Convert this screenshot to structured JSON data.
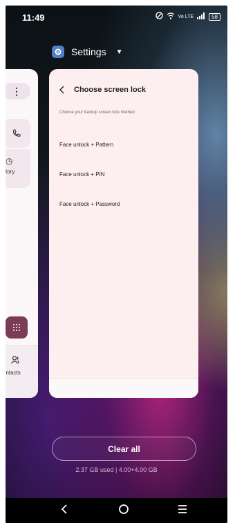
{
  "status_bar": {
    "time": "11:49",
    "icons": [
      "nfc-icon",
      "wifi-icon",
      "volte-icon",
      "signal-icon",
      "battery-icon"
    ],
    "volte_label": "Vo LTE",
    "battery_label": "58"
  },
  "recent_app": {
    "name": "Settings"
  },
  "left_card": {
    "history_label": "story",
    "contacts_label": "ontacts"
  },
  "settings_card": {
    "title": "Choose screen lock",
    "subtitle": "Choose your backup screen lock method",
    "options": [
      "Face unlock + Pattern",
      "Face unlock + PIN",
      "Face unlock + Password"
    ]
  },
  "actions": {
    "clear_all": "Clear all",
    "memory": "2.37 GB used | 4.00+4.00 GB"
  },
  "colors": {
    "card_bg": "#fdeff0",
    "settings_icon_bg": "#4f7fc8",
    "fab_bg": "#7b3c55"
  }
}
